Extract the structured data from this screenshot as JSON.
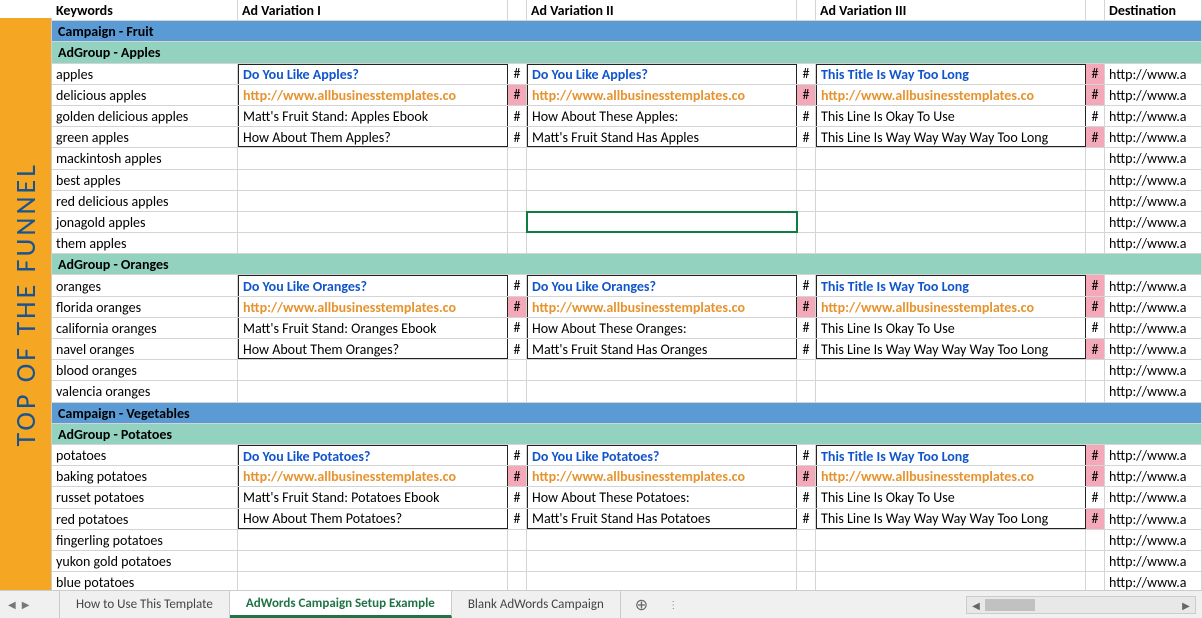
{
  "side_label": "TOP OF THE FUNNEL",
  "headers": {
    "keywords": "Keywords",
    "ad1": "Ad Variation I",
    "ad2": "Ad Variation II",
    "ad3": "Ad Variation III",
    "dest": "Destination"
  },
  "hash": "#",
  "dest_base": "http://www.a",
  "campaigns": [
    {
      "title": "Campaign - Fruit",
      "adgroups": [
        {
          "title": "AdGroup - Apples",
          "keywords": [
            "apples",
            "delicious apples",
            "golden delicious apples",
            "green apples",
            "mackintosh apples",
            "best apples",
            "red delicious apples",
            "jonagold apples",
            "them apples"
          ],
          "ads": [
            {
              "title": "Do You Like Apples?",
              "url": "http://www.allbusinesstemplates.co",
              "line1": "Matt's Fruit Stand: Apples Ebook",
              "line2": "How About Them Apples?",
              "h1_err": false,
              "h2_err": true,
              "h3_err": false,
              "h4_err": false
            },
            {
              "title": "Do You Like Apples?",
              "url": "http://www.allbusinesstemplates.co",
              "line1": "How About These Apples:",
              "line2": "Matt's Fruit Stand Has Apples",
              "h1_err": false,
              "h2_err": true,
              "h3_err": false,
              "h4_err": false
            },
            {
              "title": "This Title Is Way Too Long",
              "url": "http://www.allbusinesstemplates.co",
              "line1": "This Line Is Okay To Use",
              "line2": "This Line Is Way Way Way Way Too Long",
              "h1_err": true,
              "h2_err": true,
              "h3_err": false,
              "h4_err": true
            }
          ]
        },
        {
          "title": "AdGroup - Oranges",
          "keywords": [
            "oranges",
            "florida oranges",
            "california oranges",
            "navel oranges",
            "blood oranges",
            "valencia oranges"
          ],
          "ads": [
            {
              "title": "Do You Like Oranges?",
              "url": "http://www.allbusinesstemplates.co",
              "line1": "Matt's Fruit Stand: Oranges Ebook",
              "line2": "How About Them Oranges?",
              "h1_err": false,
              "h2_err": true,
              "h3_err": false,
              "h4_err": false
            },
            {
              "title": "Do You Like Oranges?",
              "url": "http://www.allbusinesstemplates.co",
              "line1": "How About These Oranges:",
              "line2": "Matt's Fruit Stand Has Oranges",
              "h1_err": false,
              "h2_err": true,
              "h3_err": false,
              "h4_err": false
            },
            {
              "title": "This Title Is Way Too Long",
              "url": "http://www.allbusinesstemplates.co",
              "line1": "This Line Is Okay To Use",
              "line2": "This Line Is Way Way Way Way Too Long",
              "h1_err": true,
              "h2_err": true,
              "h3_err": false,
              "h4_err": true
            }
          ]
        }
      ]
    },
    {
      "title": "Campaign - Vegetables",
      "adgroups": [
        {
          "title": "AdGroup - Potatoes",
          "keywords": [
            "potatoes",
            "baking potatoes",
            "russet potatoes",
            "red potatoes",
            "fingerling potatoes",
            "yukon gold potatoes",
            "blue potatoes"
          ],
          "ads": [
            {
              "title": "Do You Like Potatoes?",
              "url": "http://www.allbusinesstemplates.co",
              "line1": "Matt's Fruit Stand: Potatoes Ebook",
              "line2": "How About Them Potatoes?",
              "h1_err": false,
              "h2_err": true,
              "h3_err": false,
              "h4_err": false
            },
            {
              "title": "Do You Like Potatoes?",
              "url": "http://www.allbusinesstemplates.co",
              "line1": "How About These Potatoes:",
              "line2": "Matt's Fruit Stand Has Potatoes",
              "h1_err": false,
              "h2_err": true,
              "h3_err": false,
              "h4_err": false
            },
            {
              "title": "This Title Is Way Too Long",
              "url": "http://www.allbusinesstemplates.co",
              "line1": "This Line Is Okay To Use",
              "line2": "This Line Is Way Way Way Way Too Long",
              "h1_err": true,
              "h2_err": true,
              "h3_err": false,
              "h4_err": true
            }
          ]
        }
      ]
    }
  ],
  "selected_cell": {
    "campaign": 0,
    "adgroup": 0,
    "row": 7,
    "col": "ad2"
  },
  "tabs": {
    "items": [
      "How to Use This Template",
      "AdWords Campaign Setup Example",
      "Blank AdWords Campaign"
    ],
    "active": 1,
    "add": "⊕"
  }
}
